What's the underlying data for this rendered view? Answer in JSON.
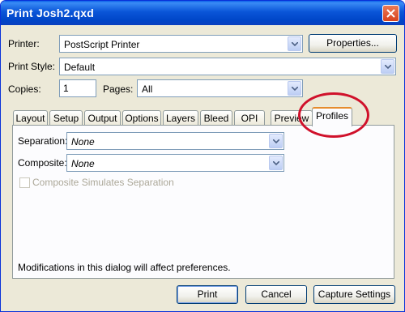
{
  "window": {
    "title": "Print Josh2.qxd"
  },
  "fields": {
    "printer_label": "Printer:",
    "printer_value": "PostScript Printer",
    "properties_button": "Properties...",
    "print_style_label": "Print Style:",
    "print_style_value": "Default",
    "copies_label": "Copies:",
    "copies_value": "1",
    "pages_label": "Pages:",
    "pages_value": "All"
  },
  "tabs": [
    "Layout",
    "Setup",
    "Output",
    "Options",
    "Layers",
    "Bleed",
    "OPI",
    "Preview",
    "Profiles"
  ],
  "active_tab": "Profiles",
  "profiles": {
    "separation_label": "Separation:",
    "separation_value": "None",
    "composite_label": "Composite:",
    "composite_value": "None",
    "composite_simulates_label": "Composite Simulates Separation"
  },
  "note": "Modifications in this dialog will affect preferences.",
  "buttons": {
    "print": "Print",
    "cancel": "Cancel",
    "capture": "Capture Settings"
  },
  "colors": {
    "titlebar": "#0a55d8",
    "dialog_bg": "#ece9d8",
    "close_button": "#d8431c",
    "highlight_circle": "#d0112b",
    "active_tab_accent": "#e68b2c"
  }
}
